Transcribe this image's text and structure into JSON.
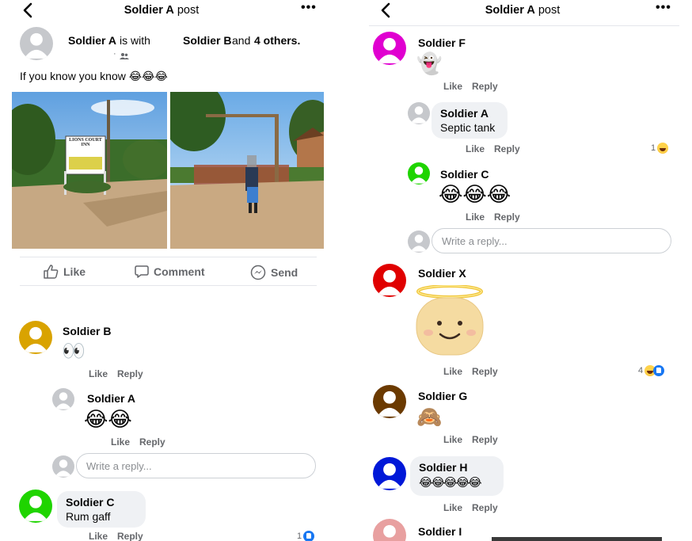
{
  "left": {
    "header": {
      "author": "Soldier A",
      "suffix": "post",
      "more": "•••"
    },
    "post": {
      "author": "Soldier A",
      "is_with": "is with",
      "tagged": "Soldier B",
      "and": "and",
      "others": "4 others.",
      "privacy": "·",
      "caption": "If you know you know 😂😂😂",
      "photo_left_sign": "LIONS COURT INN",
      "actions": {
        "like": "Like",
        "comment": "Comment",
        "send": "Send"
      }
    },
    "comments": [
      {
        "author": "Soldier B",
        "emoji": "👀",
        "like": "Like",
        "reply": "Reply",
        "avatar_color": "#d9a300"
      },
      {
        "author": "Soldier A",
        "emoji": "😂😂",
        "like": "Like",
        "reply": "Reply",
        "avatar_color": "#c6c8cc"
      },
      {
        "author": "Soldier C",
        "text": "Rum gaff",
        "like": "Like",
        "reply": "Reply",
        "reaction_count": "1",
        "avatar_color": "#1fd400"
      }
    ],
    "reply_placeholder": "Write a reply..."
  },
  "right": {
    "header": {
      "author": "Soldier A",
      "suffix": "post",
      "more": "•••"
    },
    "comments": [
      {
        "author": "Soldier F",
        "emoji": "👻",
        "like": "Like",
        "reply": "Reply",
        "avatar_color": "#e000d0"
      },
      {
        "author": "Soldier A",
        "text": "Septic tank",
        "like": "Like",
        "reply": "Reply",
        "reaction_count": "1",
        "avatar_color": "#c6c8cc"
      },
      {
        "author": "Soldier C",
        "emoji": "😂😂😂",
        "like": "Like",
        "reply": "Reply",
        "avatar_color": "#1fd400"
      },
      {
        "author": "Soldier X",
        "emoji": "😇",
        "like": "Like",
        "reply": "Reply",
        "reaction_count": "4",
        "avatar_color": "#e00000"
      },
      {
        "author": "Soldier G",
        "emoji": "🙈",
        "like": "Like",
        "reply": "Reply",
        "avatar_color": "#6b3a00"
      },
      {
        "author": "Soldier H",
        "emoji": "😂😂😂😂😂",
        "like": "Like",
        "reply": "Reply",
        "avatar_color": "#0018d8"
      },
      {
        "author": "Soldier I",
        "avatar_color": "#e8a0a0"
      }
    ],
    "reply_placeholder": "Write a reply..."
  }
}
